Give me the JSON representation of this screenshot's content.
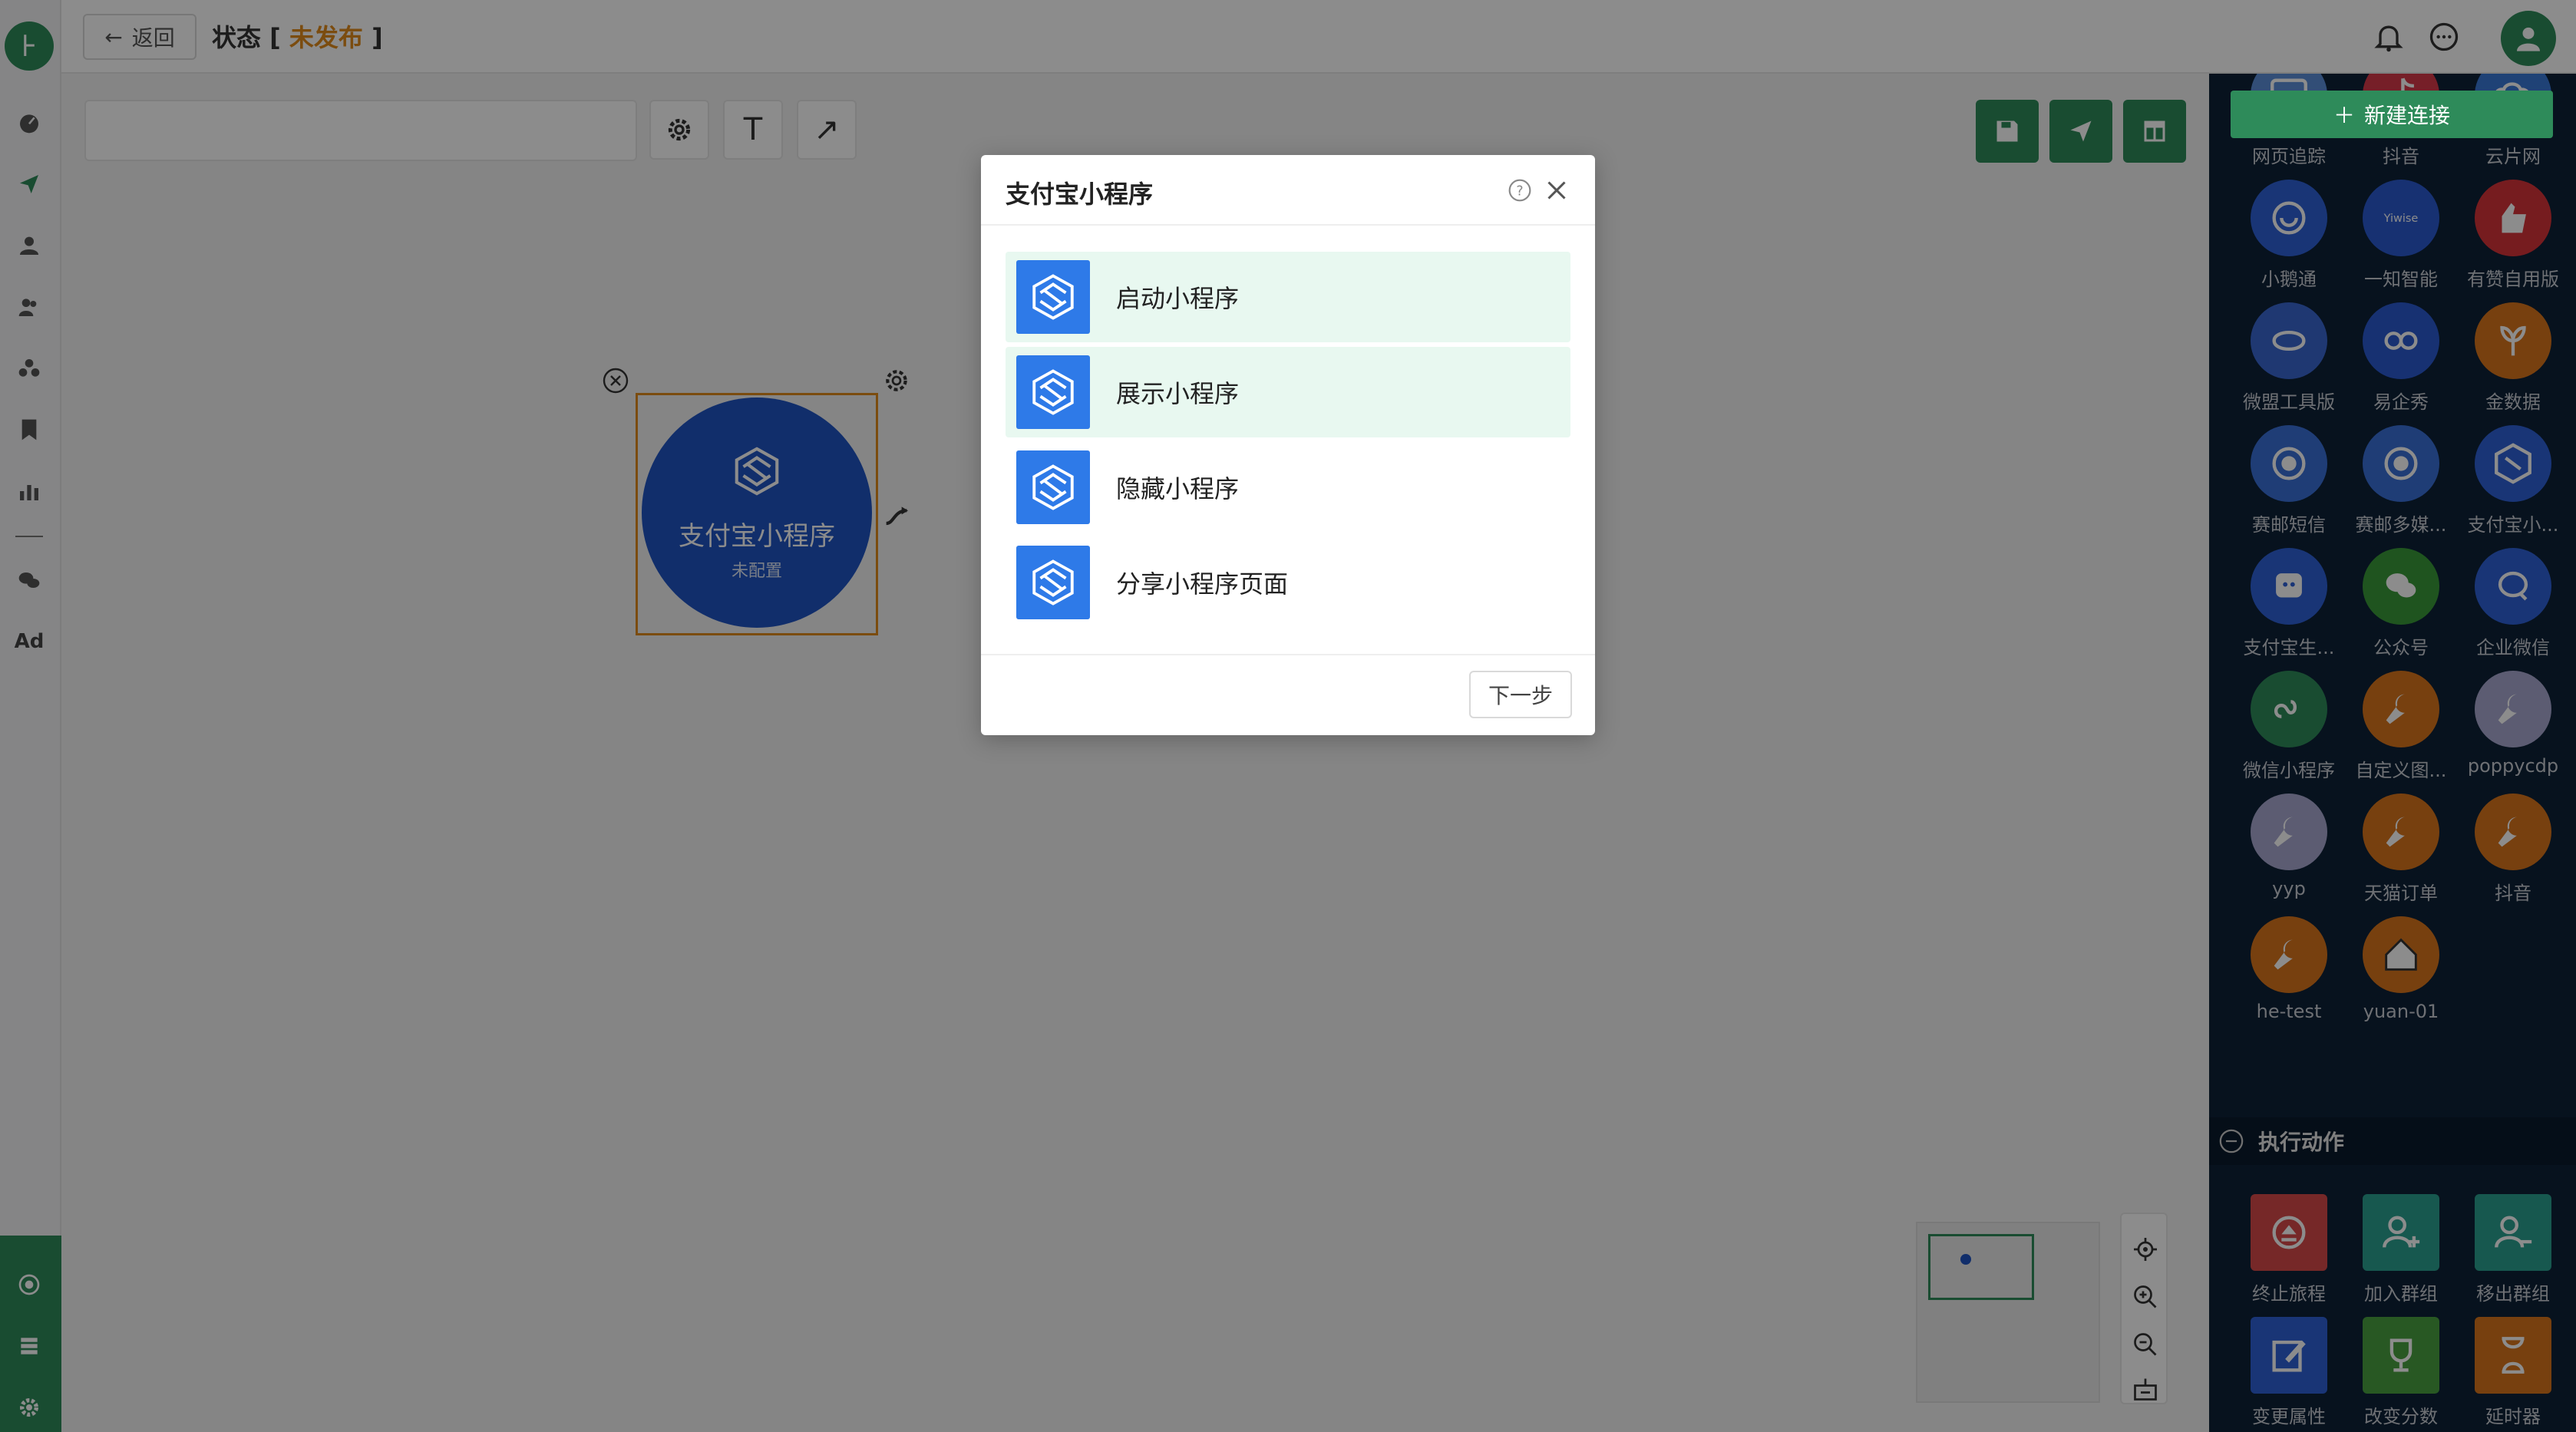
{
  "header": {
    "back_label": "返回",
    "status_prefix": "状态 [ ",
    "status_value": "未发布",
    "status_suffix": " ]"
  },
  "node": {
    "title": "支付宝小程序",
    "subtitle": "未配置"
  },
  "modal": {
    "title": "支付宝小程序",
    "options": [
      {
        "label": "启动小程序",
        "selected": true
      },
      {
        "label": "展示小程序",
        "selected": true
      },
      {
        "label": "隐藏小程序",
        "selected": false
      },
      {
        "label": "分享小程序页面",
        "selected": false
      }
    ],
    "next_label": "下一步"
  },
  "left_nav": {
    "ad_label": "Ad"
  },
  "right_panel": {
    "new_connection_label": "新建连接",
    "connectors": [
      {
        "label": "网页追踪",
        "icon": "web-tracking-icon",
        "color": "#5b8fd9"
      },
      {
        "label": "抖音",
        "icon": "tiktok-icon",
        "color": "#d83a4a"
      },
      {
        "label": "云片网",
        "icon": "cloud-link-icon",
        "color": "#3a78d8"
      },
      {
        "label": "小鹅通",
        "icon": "xiaoe-icon",
        "color": "#2e62d8"
      },
      {
        "label": "一知智能",
        "icon": "yiwise-icon",
        "color": "#2a5ad0"
      },
      {
        "label": "有赞自用版",
        "icon": "youzan-icon",
        "color": "#d8343a"
      },
      {
        "label": "微盟工具版",
        "icon": "weimob-icon",
        "color": "#3a66d0"
      },
      {
        "label": "易企秀",
        "icon": "eqxiu-icon",
        "color": "#2a5ad0"
      },
      {
        "label": "金数据",
        "icon": "jinshuju-icon",
        "color": "#d9751c"
      },
      {
        "label": "赛邮短信",
        "icon": "submail-sms-icon",
        "color": "#3a70d8"
      },
      {
        "label": "赛邮多媒...",
        "icon": "submail-media-icon",
        "color": "#3a70d8"
      },
      {
        "label": "支付宝小...",
        "icon": "alipay-mini-icon",
        "color": "#2e62d8"
      },
      {
        "label": "支付宝生...",
        "icon": "alipay-life-icon",
        "color": "#2e62d8"
      },
      {
        "label": "公众号",
        "icon": "wechat-icon",
        "color": "#3a9a3a"
      },
      {
        "label": "企业微信",
        "icon": "wecom-icon",
        "color": "#2e62d8"
      },
      {
        "label": "微信小程序",
        "icon": "wechat-mini-icon",
        "color": "#2e8b5a"
      },
      {
        "label": "自定义图...",
        "icon": "wrench-icon",
        "color": "#d9751c"
      },
      {
        "label": "poppycdp",
        "icon": "wrench-icon",
        "color": "#a8a8d0"
      },
      {
        "label": "yyp",
        "icon": "wrench-icon",
        "color": "#a8a8d0"
      },
      {
        "label": "天猫订单",
        "icon": "wrench-icon",
        "color": "#d9751c"
      },
      {
        "label": "抖音",
        "icon": "wrench-icon",
        "color": "#d9751c"
      },
      {
        "label": "he-test",
        "icon": "wrench-icon",
        "color": "#d9751c"
      },
      {
        "label": "yuan-01",
        "icon": "house-icon",
        "color": "#d9751c"
      }
    ],
    "section_label": "执行动作",
    "actions": [
      {
        "label": "终止旅程",
        "icon": "eject-icon",
        "color": "#d84a4a"
      },
      {
        "label": "加入群组",
        "icon": "user-add-icon",
        "color": "#2aa090"
      },
      {
        "label": "移出群组",
        "icon": "user-remove-icon",
        "color": "#2aa090"
      },
      {
        "label": "变更属性",
        "icon": "edit-icon",
        "color": "#2e62d8"
      },
      {
        "label": "改变分数",
        "icon": "trophy-icon",
        "color": "#4aa040"
      },
      {
        "label": "延时器",
        "icon": "hourglass-icon",
        "color": "#d9751c"
      }
    ]
  }
}
